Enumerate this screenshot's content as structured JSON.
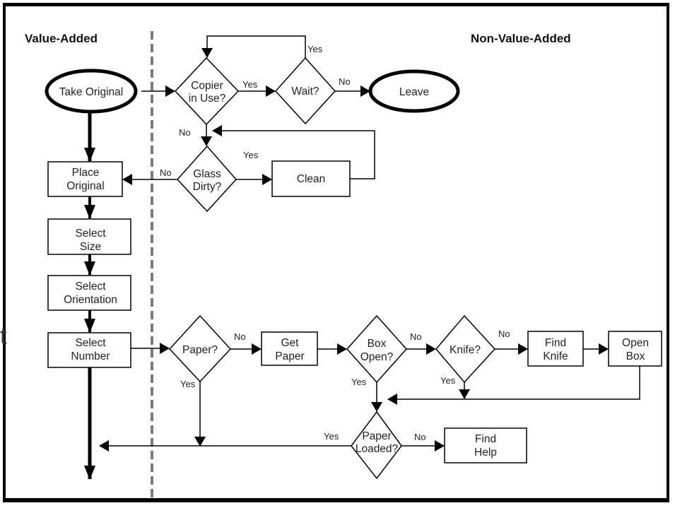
{
  "headers": {
    "left": "Value-Added",
    "right": "Non-Value-Added"
  },
  "stray_text": "t",
  "colors": {
    "line": "#000000",
    "divider": "#7a7a7a",
    "text": "#222222"
  },
  "nodes": {
    "take_original": {
      "shape": "ellipse",
      "lines": [
        "Take Original"
      ]
    },
    "copier_in_use": {
      "shape": "diamond",
      "lines": [
        "Copier",
        "in Use?"
      ]
    },
    "wait": {
      "shape": "diamond",
      "lines": [
        "Wait?"
      ]
    },
    "leave": {
      "shape": "ellipse",
      "lines": [
        "Leave"
      ]
    },
    "glass_dirty": {
      "shape": "diamond",
      "lines": [
        "Glass",
        "Dirty?"
      ]
    },
    "clean": {
      "shape": "box",
      "lines": [
        "Clean"
      ]
    },
    "place_original": {
      "shape": "box",
      "lines": [
        "Place",
        "Original"
      ]
    },
    "select_size": {
      "shape": "box",
      "lines": [
        "Select",
        "Size"
      ]
    },
    "select_orientation": {
      "shape": "box",
      "lines": [
        "Select",
        "Orientation"
      ]
    },
    "select_number": {
      "shape": "box",
      "lines": [
        "Select",
        "Number"
      ]
    },
    "paper": {
      "shape": "diamond",
      "lines": [
        "Paper?"
      ]
    },
    "get_paper": {
      "shape": "box",
      "lines": [
        "Get",
        "Paper"
      ]
    },
    "box_open": {
      "shape": "diamond",
      "lines": [
        "Box",
        "Open?"
      ]
    },
    "knife": {
      "shape": "diamond",
      "lines": [
        "Knife?"
      ]
    },
    "find_knife": {
      "shape": "box",
      "lines": [
        "Find",
        "Knife"
      ]
    },
    "open_box": {
      "shape": "box",
      "lines": [
        "Open",
        "Box"
      ]
    },
    "paper_loaded": {
      "shape": "diamond",
      "lines": [
        "Paper",
        "Loaded?"
      ]
    },
    "find_help": {
      "shape": "box",
      "lines": [
        "Find",
        "Help"
      ]
    }
  },
  "edge_labels": {
    "copier_yes": "Yes",
    "copier_no": "No",
    "wait_yes": "Yes",
    "wait_no": "No",
    "glass_yes": "Yes",
    "glass_no": "No",
    "paper_no": "No",
    "paper_yes": "Yes",
    "box_open_no": "No",
    "box_open_yes": "Yes",
    "knife_no": "No",
    "knife_yes": "Yes",
    "paper_loaded_yes": "Yes",
    "paper_loaded_no": "No"
  }
}
